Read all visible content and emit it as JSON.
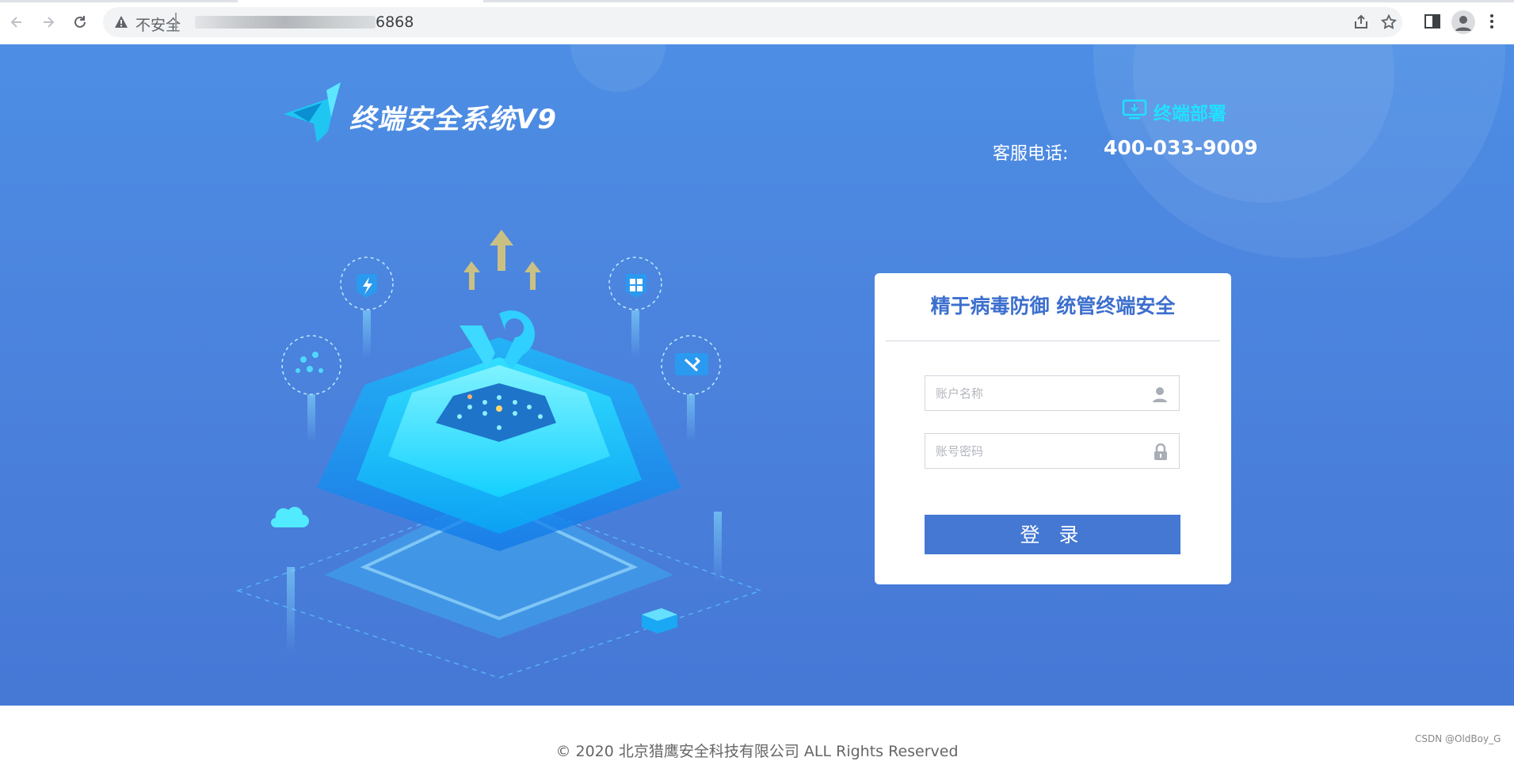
{
  "browser": {
    "security_label": "不安全",
    "url_visible": "6868",
    "icons": [
      "back-arrow-icon",
      "forward-arrow-icon",
      "reload-icon",
      "warning-icon",
      "share-icon",
      "star-icon",
      "side-panel-icon",
      "profile-icon",
      "menu-kebab-icon"
    ]
  },
  "header": {
    "logo_text": "终端安全系统V9",
    "deploy_link": "终端部署",
    "hotline_label": "客服电话:",
    "hotline_number": "400-033-9009"
  },
  "login": {
    "title": "精于病毒防御  统管终端安全",
    "username_placeholder": "账户名称",
    "password_placeholder": "账号密码",
    "submit_label": "登 录"
  },
  "footer": {
    "copyright": "© 2020 北京猎鹰安全科技有限公司 ALL Rights Reserved",
    "watermark": "CSDN @OldBoy_G"
  },
  "colors": {
    "background_blue": "#4b84de",
    "accent_cyan": "#22e0ff",
    "button_blue": "#4478d2",
    "title_blue": "#3c6fce"
  }
}
